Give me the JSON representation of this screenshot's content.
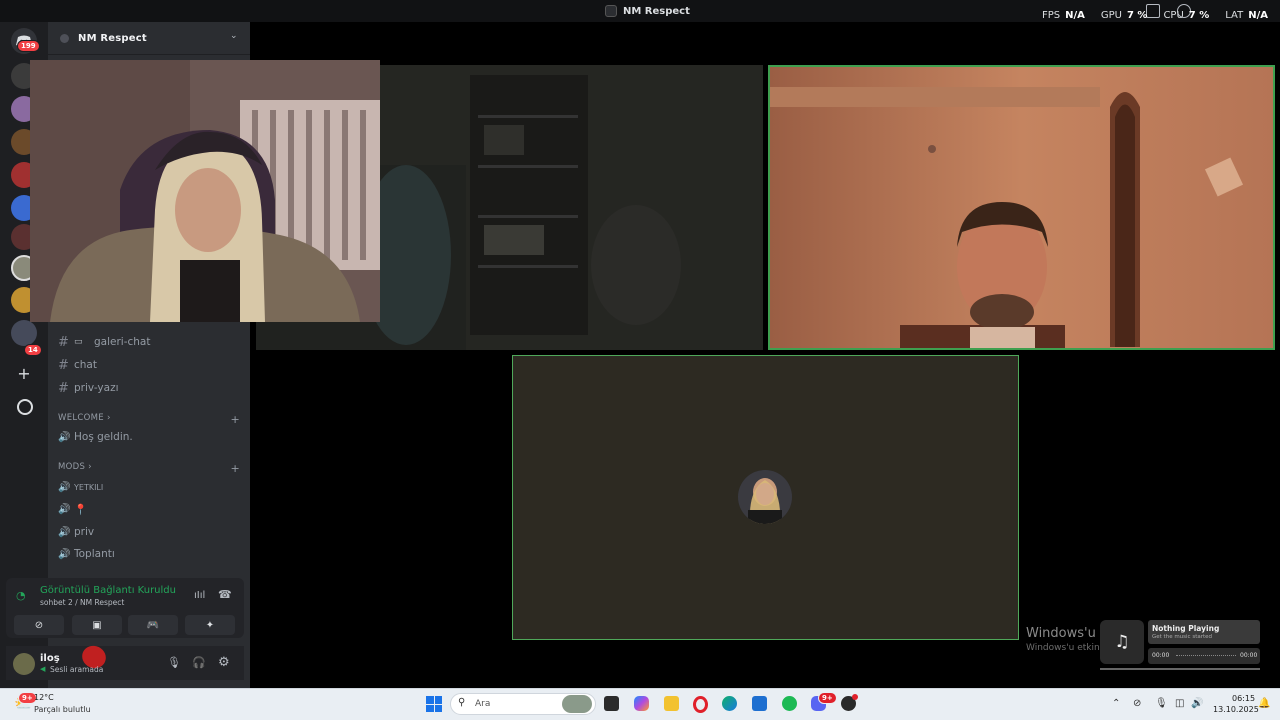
{
  "window": {
    "title": "NM Respect",
    "stats": [
      {
        "label": "FPS",
        "value": "N/A"
      },
      {
        "label": "GPU",
        "value": "7 %"
      },
      {
        "label": "CPU",
        "value": "7 %"
      },
      {
        "label": "LAT",
        "value": "N/A"
      }
    ]
  },
  "rail": {
    "home_badge": "199",
    "badges": [
      "14"
    ]
  },
  "server": {
    "name": "NM Respect"
  },
  "channels": {
    "text": [
      {
        "label": "galeri-chat"
      },
      {
        "label": "chat"
      },
      {
        "label": "priv-yazı"
      }
    ],
    "welcome": {
      "category": "WELCOME",
      "items": [
        {
          "label": "Hoş geldin."
        }
      ]
    },
    "mods": {
      "category": "MODS",
      "items": [
        {
          "label": "YETKILI"
        },
        {
          "label": "📍"
        },
        {
          "label": "priv"
        },
        {
          "label": "Toplantı"
        }
      ]
    }
  },
  "voice": {
    "status": "Görüntülü Bağlantı Kuruldu",
    "sub": "sohbet 2 / NM Respect"
  },
  "user": {
    "name": "iloş",
    "status": "Sesli aramada"
  },
  "watermark": {
    "title": "Windows'u E",
    "sub": "Windows'u etkin"
  },
  "music": {
    "title": "Nothing Playing",
    "sub": "Get the music started",
    "time_start": "00:00",
    "time_end": "00:00"
  },
  "taskbar": {
    "weather_badge": "9+",
    "temp": "12°C",
    "weather": "Parçalı bulutlu",
    "search_placeholder": "Ara",
    "time": "06:15",
    "date": "13.10.2025",
    "discord_badge": "9+"
  }
}
